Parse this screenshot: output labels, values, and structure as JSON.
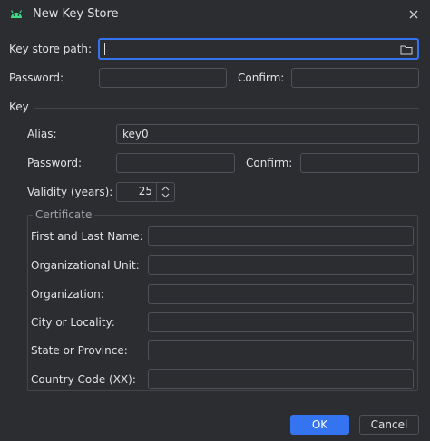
{
  "window": {
    "title": "New Key Store"
  },
  "keystore": {
    "path_label": "Key store path:",
    "path_value": "",
    "password_label": "Password:",
    "confirm_label": "Confirm:"
  },
  "key": {
    "section_label": "Key",
    "alias_label": "Alias:",
    "alias_value": "key0",
    "password_label": "Password:",
    "confirm_label": "Confirm:",
    "validity_label": "Validity (years):",
    "validity_value": "25"
  },
  "certificate": {
    "title": "Certificate",
    "fields": [
      {
        "label": "First and Last Name:",
        "value": ""
      },
      {
        "label": "Organizational Unit:",
        "value": ""
      },
      {
        "label": "Organization:",
        "value": ""
      },
      {
        "label": "City or Locality:",
        "value": ""
      },
      {
        "label": "State or Province:",
        "value": ""
      },
      {
        "label": "Country Code (XX):",
        "value": ""
      }
    ]
  },
  "buttons": {
    "ok": "OK",
    "cancel": "Cancel"
  },
  "colors": {
    "background": "#2b2d30",
    "accent": "#3574f0",
    "android_green": "#3ddc84"
  },
  "icons": {
    "window": "android-icon",
    "close": "close-icon",
    "browse": "folder-icon",
    "spinner": "up-down-arrows-icon"
  }
}
